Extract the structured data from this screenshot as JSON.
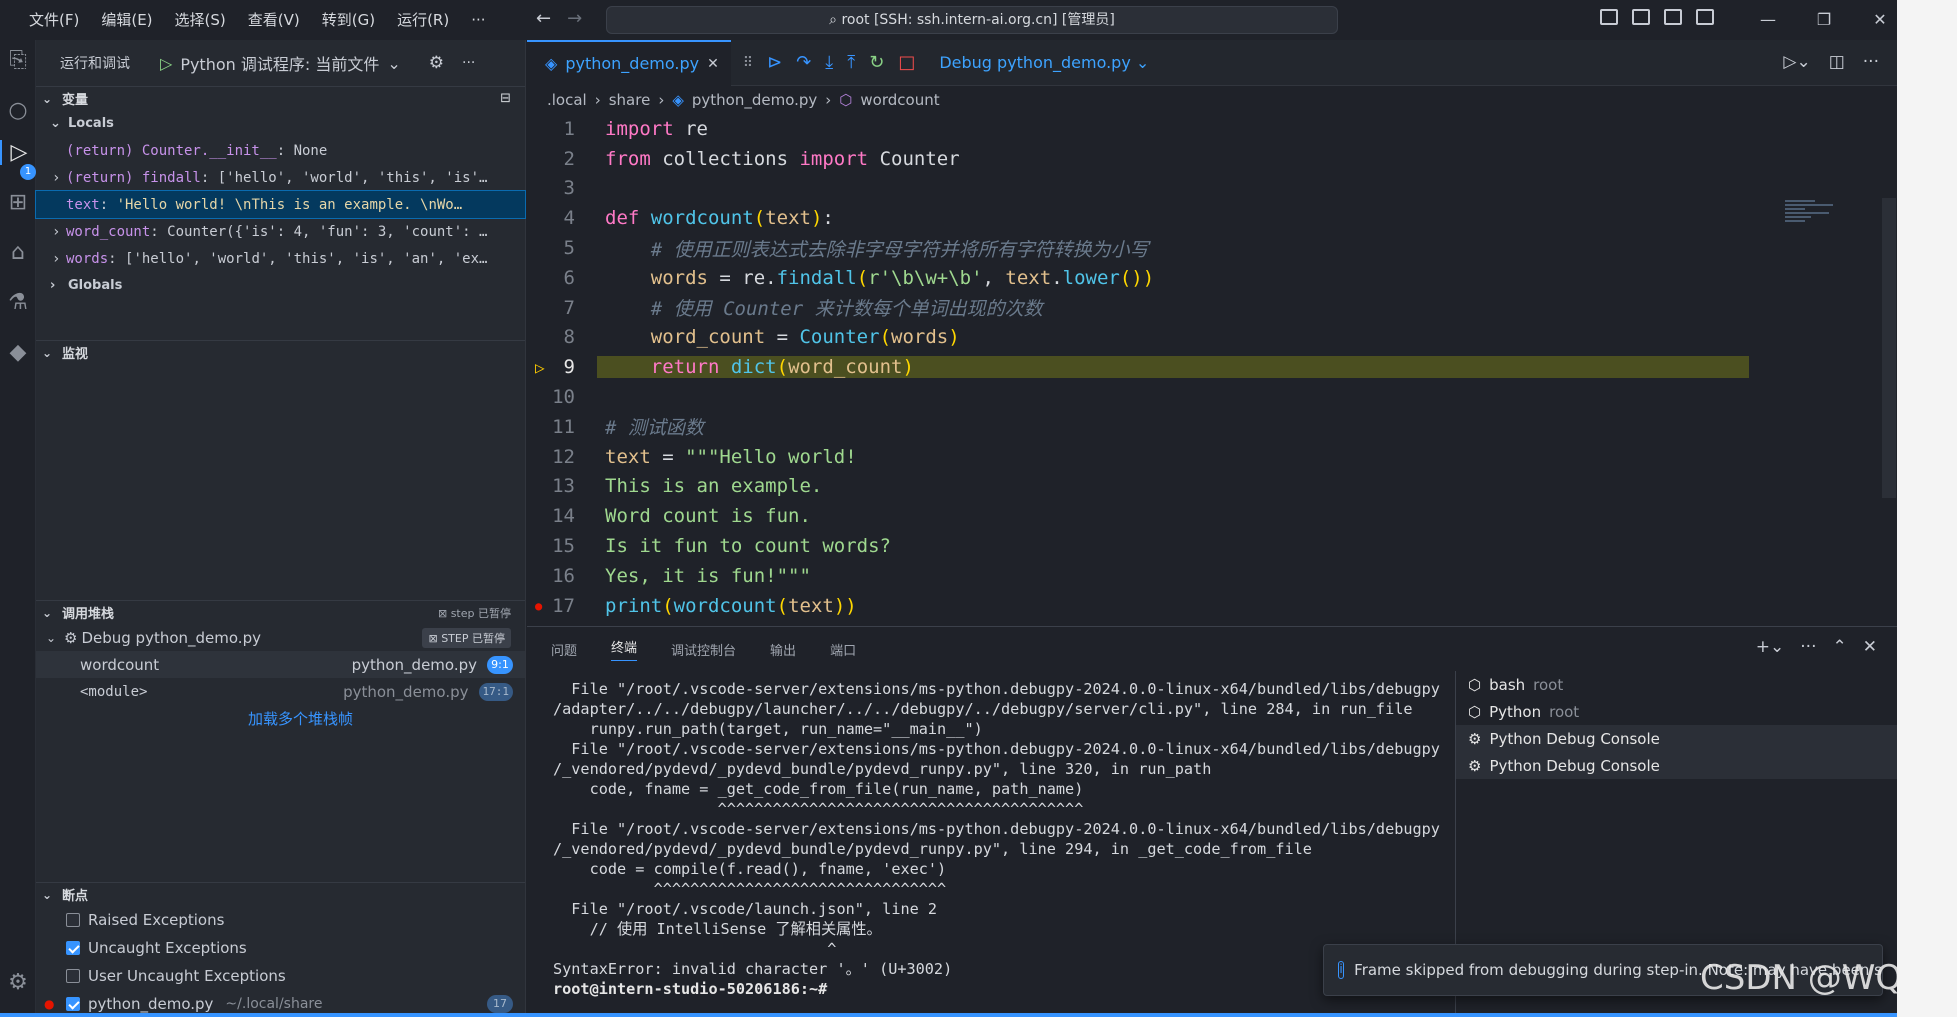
{
  "menu": [
    "文件(F)",
    "编辑(E)",
    "选择(S)",
    "查看(V)",
    "转到(G)",
    "运行(R)",
    "···"
  ],
  "command_center": "root [SSH: ssh.intern-ai.org.cn] [管理员]",
  "sidebar": {
    "title": "运行和调试",
    "launch_config": "Python 调试程序: 当前文件",
    "variables_title": "变量",
    "locals_label": "Locals",
    "globals_label": "Globals",
    "variables": [
      {
        "name": "(return) Counter.__init__",
        "value": "None",
        "expandable": false
      },
      {
        "name": "(return) findall",
        "value": "['hello', 'world', 'this', 'is'…",
        "expandable": true
      },
      {
        "name": "text",
        "value": "'Hello world!  \\nThis is an example.  \\nWo…",
        "expandable": false,
        "selected": true
      },
      {
        "name": "word_count",
        "value": "Counter({'is': 4, 'fun': 3, 'count': …",
        "expandable": true
      },
      {
        "name": "words",
        "value": "['hello', 'world', 'this', 'is', 'an', 'ex…",
        "expandable": true
      }
    ],
    "watch_title": "监视",
    "callstack_title": "调用堆栈",
    "callstack_status": "step 已暂停",
    "session_name": "Debug python_demo.py",
    "session_status": "STEP 已暂停",
    "frames": [
      {
        "name": "wordcount",
        "file": "python_demo.py",
        "pos": "9:1"
      },
      {
        "name": "<module>",
        "file": "python_demo.py",
        "pos": "17:1"
      }
    ],
    "load_more": "加载多个堆栈帧",
    "breakpoints_title": "断点",
    "breakpoints": [
      {
        "label": "Raised Exceptions",
        "checked": false
      },
      {
        "label": "Uncaught Exceptions",
        "checked": true
      },
      {
        "label": "User Uncaught Exceptions",
        "checked": false
      }
    ],
    "bp_file": {
      "label": "python_demo.py",
      "path": "~/.local/share",
      "line": "17"
    }
  },
  "editor": {
    "tab_label": "python_demo.py",
    "debug_config": "Debug python_demo.py",
    "breadcrumb": [
      ".local",
      "share",
      "python_demo.py",
      "wordcount"
    ],
    "current_line": 9,
    "breakpoint_line": 17
  },
  "panel": {
    "tabs": [
      "问题",
      "终端",
      "调试控制台",
      "输出",
      "端口"
    ],
    "active_tab": "终端",
    "terminal_lines": [
      "  File \"/root/.vscode-server/extensions/ms-python.debugpy-2024.0.0-linux-x64/bundled/libs/debugpy",
      "/adapter/../../debugpy/launcher/../../debugpy/../debugpy/server/cli.py\", line 284, in run_file",
      "    runpy.run_path(target, run_name=\"__main__\")",
      "  File \"/root/.vscode-server/extensions/ms-python.debugpy-2024.0.0-linux-x64/bundled/libs/debugpy",
      "/_vendored/pydevd/_pydevd_bundle/pydevd_runpy.py\", line 320, in run_path",
      "    code, fname = _get_code_from_file(run_name, path_name)",
      "                  ^^^^^^^^^^^^^^^^^^^^^^^^^^^^^^^^^^^^^^^^",
      "  File \"/root/.vscode-server/extensions/ms-python.debugpy-2024.0.0-linux-x64/bundled/libs/debugpy",
      "/_vendored/pydevd/_pydevd_bundle/pydevd_runpy.py\", line 294, in _get_code_from_file",
      "    code = compile(f.read(), fname, 'exec')",
      "           ^^^^^^^^^^^^^^^^^^^^^^^^^^^^^^^^",
      "  File \"/root/.vscode/launch.json\", line 2",
      "    // 使用 IntelliSense 了解相关属性。",
      "                              ^",
      "SyntaxError: invalid character '。' (U+3002)"
    ],
    "prompt": "root@intern-studio-50206186:~#",
    "terminals": [
      {
        "name": "bash",
        "sub": "root"
      },
      {
        "name": "Python",
        "sub": "root"
      },
      {
        "name": "Python Debug Console",
        "sub": ""
      },
      {
        "name": "Python Debug Console",
        "sub": ""
      }
    ]
  },
  "toast": "Frame skipped from debugging during step-in. Note: may have been s",
  "watermark": "CSDN @WQML",
  "colors": {
    "accent": "#3794ff",
    "current_line": "#4b4f20",
    "breakpoint": "#e51400"
  }
}
